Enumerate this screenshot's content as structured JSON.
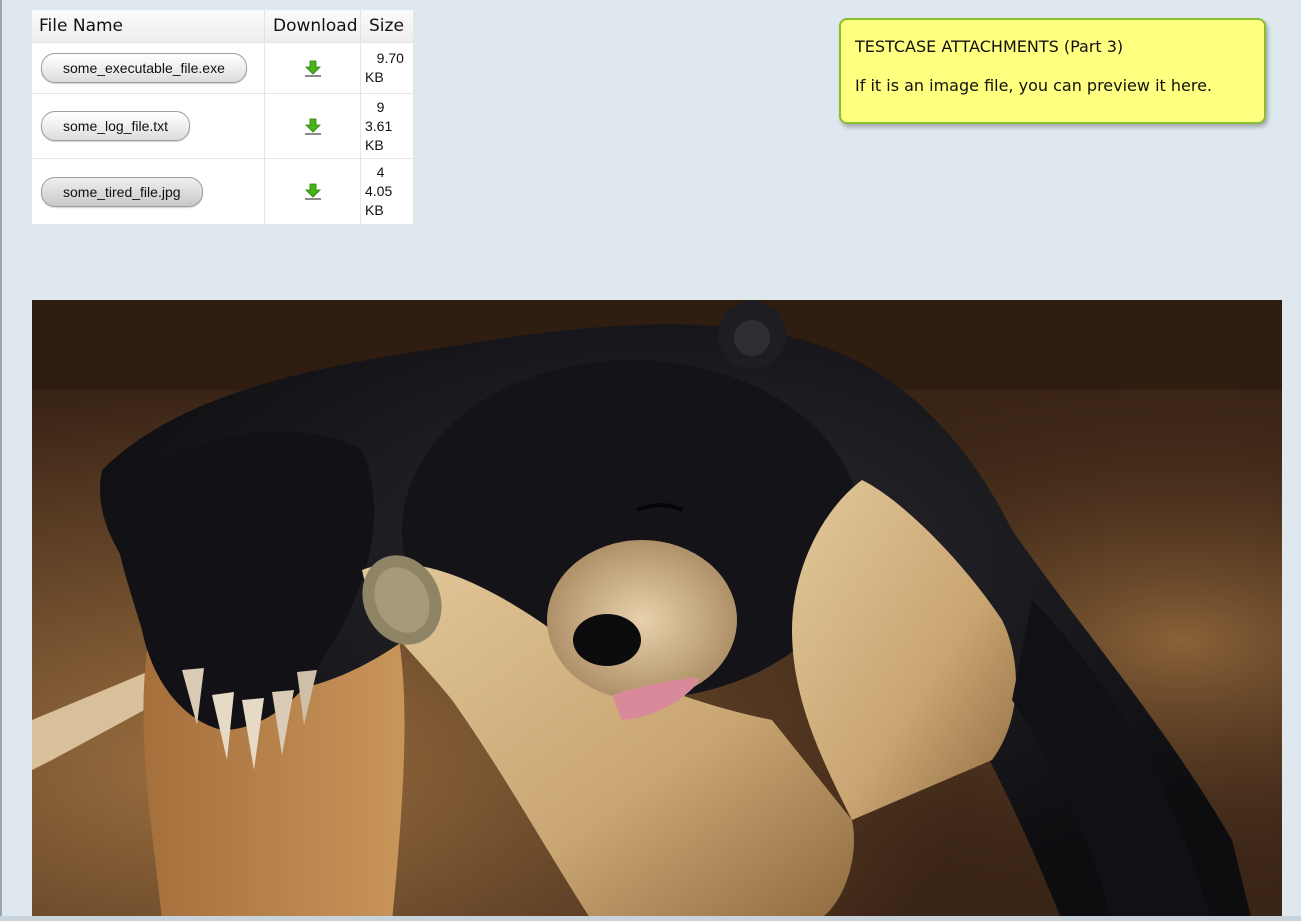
{
  "attachments": {
    "columns": [
      "File Name",
      "Download",
      "Size"
    ],
    "rows": [
      {
        "file_name": "some_executable_file.exe",
        "download_icon": "download-arrow-icon",
        "size": "   9.70\nKB"
      },
      {
        "file_name": "some_log_file.txt",
        "download_icon": "download-arrow-icon",
        "size": "   9\n3.61\nKB"
      },
      {
        "file_name": "some_tired_file.jpg",
        "download_icon": "download-arrow-icon",
        "size": "   4\n4.05\nKB"
      }
    ]
  },
  "note": {
    "title": "TESTCASE ATTACHMENTS (Part 3)",
    "body": "If it is an image file, you can preview it here."
  },
  "preview": {
    "subject": "photo of a sleeping black bear draped over a tree branch"
  },
  "colors": {
    "page_background": "#dfe8ef",
    "note_background": "#ffff80",
    "note_border": "#8bbd2e",
    "download_icon": "#44b515"
  }
}
